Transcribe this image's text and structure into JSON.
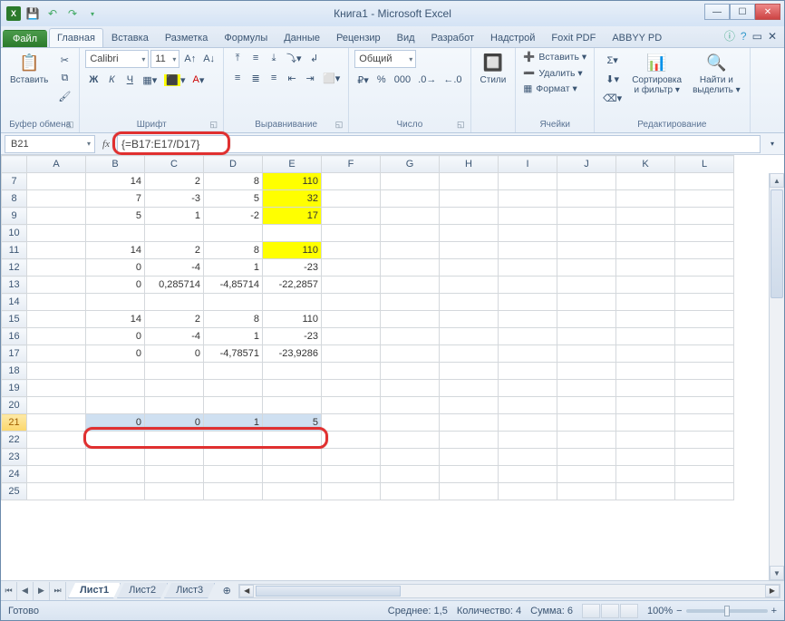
{
  "title": "Книга1 - Microsoft Excel",
  "tabs": {
    "file": "Файл",
    "list": [
      "Главная",
      "Вставка",
      "Разметка",
      "Формулы",
      "Данные",
      "Рецензир",
      "Вид",
      "Разработ",
      "Надстрой",
      "Foxit PDF",
      "ABBYY PD"
    ],
    "active": 0
  },
  "ribbon": {
    "clipboard": {
      "paste": "Вставить",
      "label": "Буфер обмена"
    },
    "font": {
      "name": "Calibri",
      "size": "11",
      "label": "Шрифт"
    },
    "align": {
      "label": "Выравнивание"
    },
    "number": {
      "format": "Общий",
      "label": "Число"
    },
    "styles": {
      "btn": "Стили"
    },
    "cells": {
      "insert": "Вставить ▾",
      "delete": "Удалить ▾",
      "format": "Формат ▾",
      "label": "Ячейки"
    },
    "editing": {
      "sort": "Сортировка\nи фильтр ▾",
      "find": "Найти и\nвыделить ▾",
      "label": "Редактирование"
    }
  },
  "namebox": "B21",
  "formula": "{=B17:E17/D17}",
  "columns": [
    "A",
    "B",
    "C",
    "D",
    "E",
    "F",
    "G",
    "H",
    "I",
    "J",
    "K",
    "L"
  ],
  "rows": [
    {
      "n": 7,
      "c": {
        "B": "14",
        "C": "2",
        "D": "8",
        "E": "110"
      },
      "y": [
        "E"
      ]
    },
    {
      "n": 8,
      "c": {
        "B": "7",
        "C": "-3",
        "D": "5",
        "E": "32"
      },
      "y": [
        "E"
      ]
    },
    {
      "n": 9,
      "c": {
        "B": "5",
        "C": "1",
        "D": "-2",
        "E": "17"
      },
      "y": [
        "E"
      ]
    },
    {
      "n": 10,
      "c": {}
    },
    {
      "n": 11,
      "c": {
        "B": "14",
        "C": "2",
        "D": "8",
        "E": "110"
      },
      "y": [
        "E"
      ]
    },
    {
      "n": 12,
      "c": {
        "B": "0",
        "C": "-4",
        "D": "1",
        "E": "-23"
      }
    },
    {
      "n": 13,
      "c": {
        "B": "0",
        "C": "0,285714",
        "D": "-4,85714",
        "E": "-22,2857"
      }
    },
    {
      "n": 14,
      "c": {}
    },
    {
      "n": 15,
      "c": {
        "B": "14",
        "C": "2",
        "D": "8",
        "E": "110"
      }
    },
    {
      "n": 16,
      "c": {
        "B": "0",
        "C": "-4",
        "D": "1",
        "E": "-23"
      }
    },
    {
      "n": 17,
      "c": {
        "B": "0",
        "C": "0",
        "D": "-4,78571",
        "E": "-23,9286"
      }
    },
    {
      "n": 18,
      "c": {}
    },
    {
      "n": 19,
      "c": {}
    },
    {
      "n": 20,
      "c": {}
    },
    {
      "n": 21,
      "c": {
        "B": "0",
        "C": "0",
        "D": "1",
        "E": "5"
      },
      "sel": [
        "B",
        "C",
        "D",
        "E"
      ],
      "selrow": true
    },
    {
      "n": 22,
      "c": {}
    },
    {
      "n": 23,
      "c": {}
    },
    {
      "n": 24,
      "c": {}
    },
    {
      "n": 25,
      "c": {}
    }
  ],
  "sheets": [
    "Лист1",
    "Лист2",
    "Лист3"
  ],
  "status": {
    "ready": "Готово",
    "avg_l": "Среднее:",
    "avg": "1,5",
    "cnt_l": "Количество:",
    "cnt": "4",
    "sum_l": "Сумма:",
    "sum": "6",
    "zoom": "100%"
  }
}
